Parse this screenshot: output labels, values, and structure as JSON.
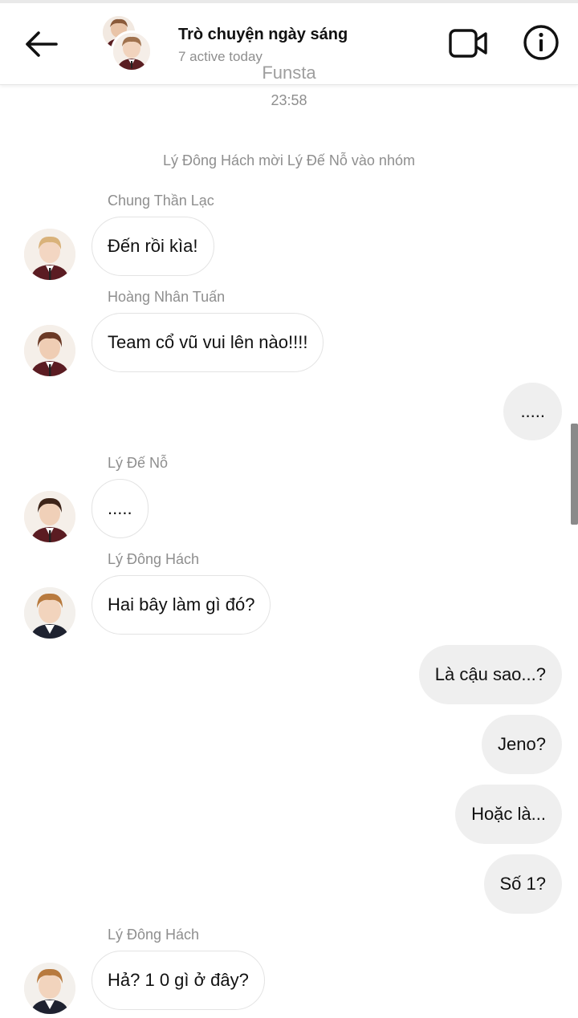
{
  "header": {
    "title": "Trò chuyện ngày sáng",
    "subtitle": "7 active today",
    "back_icon": "arrow-left-icon",
    "video_icon": "video-camera-icon",
    "info_icon": "info-circle-icon"
  },
  "watermark": "Funsta",
  "timestamp": "23:58",
  "system_message": "Lý Đông Hách mời Lý Đế Nỗ vào nhóm",
  "messages": [
    {
      "sender": "Chung Thần Lạc",
      "text": "Đến rồi kìa!"
    },
    {
      "sender": "Hoàng Nhân Tuấn",
      "text": "Team cổ vũ vui lên nào!!!!"
    },
    {
      "text": "....."
    },
    {
      "sender": "Lý Đế Nỗ",
      "text": "....."
    },
    {
      "sender": "Lý Đông Hách",
      "text": "Hai bây làm gì đó?"
    },
    {
      "text": "Là cậu sao...?"
    },
    {
      "text": "Jeno?"
    },
    {
      "text": "Hoặc là..."
    },
    {
      "text": "Số 1?"
    },
    {
      "sender": "Lý Đông Hách",
      "text": "Hả? 1 0 gì ở đây?"
    }
  ],
  "colors": {
    "outgoing_bubble": "#efefef",
    "incoming_border": "#e3e3e3",
    "muted_text": "#8e8e8e"
  }
}
